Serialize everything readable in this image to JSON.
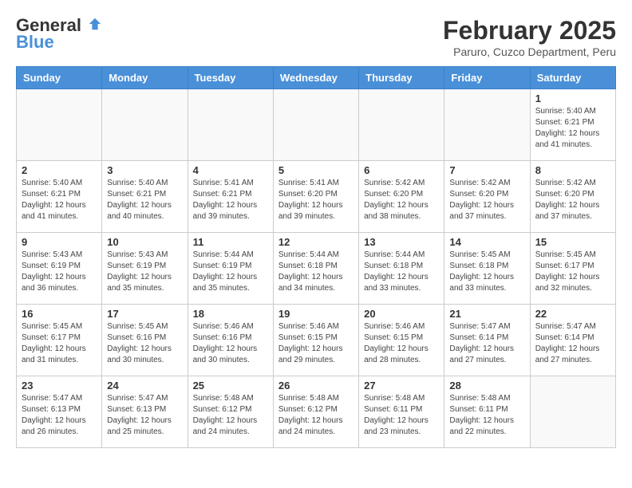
{
  "header": {
    "logo_line1": "General",
    "logo_line2": "Blue",
    "month_year": "February 2025",
    "location": "Paruro, Cuzco Department, Peru"
  },
  "weekdays": [
    "Sunday",
    "Monday",
    "Tuesday",
    "Wednesday",
    "Thursday",
    "Friday",
    "Saturday"
  ],
  "weeks": [
    [
      {
        "day": "",
        "info": ""
      },
      {
        "day": "",
        "info": ""
      },
      {
        "day": "",
        "info": ""
      },
      {
        "day": "",
        "info": ""
      },
      {
        "day": "",
        "info": ""
      },
      {
        "day": "",
        "info": ""
      },
      {
        "day": "1",
        "info": "Sunrise: 5:40 AM\nSunset: 6:21 PM\nDaylight: 12 hours and 41 minutes."
      }
    ],
    [
      {
        "day": "2",
        "info": "Sunrise: 5:40 AM\nSunset: 6:21 PM\nDaylight: 12 hours and 41 minutes."
      },
      {
        "day": "3",
        "info": "Sunrise: 5:40 AM\nSunset: 6:21 PM\nDaylight: 12 hours and 40 minutes."
      },
      {
        "day": "4",
        "info": "Sunrise: 5:41 AM\nSunset: 6:21 PM\nDaylight: 12 hours and 39 minutes."
      },
      {
        "day": "5",
        "info": "Sunrise: 5:41 AM\nSunset: 6:20 PM\nDaylight: 12 hours and 39 minutes."
      },
      {
        "day": "6",
        "info": "Sunrise: 5:42 AM\nSunset: 6:20 PM\nDaylight: 12 hours and 38 minutes."
      },
      {
        "day": "7",
        "info": "Sunrise: 5:42 AM\nSunset: 6:20 PM\nDaylight: 12 hours and 37 minutes."
      },
      {
        "day": "8",
        "info": "Sunrise: 5:42 AM\nSunset: 6:20 PM\nDaylight: 12 hours and 37 minutes."
      }
    ],
    [
      {
        "day": "9",
        "info": "Sunrise: 5:43 AM\nSunset: 6:19 PM\nDaylight: 12 hours and 36 minutes."
      },
      {
        "day": "10",
        "info": "Sunrise: 5:43 AM\nSunset: 6:19 PM\nDaylight: 12 hours and 35 minutes."
      },
      {
        "day": "11",
        "info": "Sunrise: 5:44 AM\nSunset: 6:19 PM\nDaylight: 12 hours and 35 minutes."
      },
      {
        "day": "12",
        "info": "Sunrise: 5:44 AM\nSunset: 6:18 PM\nDaylight: 12 hours and 34 minutes."
      },
      {
        "day": "13",
        "info": "Sunrise: 5:44 AM\nSunset: 6:18 PM\nDaylight: 12 hours and 33 minutes."
      },
      {
        "day": "14",
        "info": "Sunrise: 5:45 AM\nSunset: 6:18 PM\nDaylight: 12 hours and 33 minutes."
      },
      {
        "day": "15",
        "info": "Sunrise: 5:45 AM\nSunset: 6:17 PM\nDaylight: 12 hours and 32 minutes."
      }
    ],
    [
      {
        "day": "16",
        "info": "Sunrise: 5:45 AM\nSunset: 6:17 PM\nDaylight: 12 hours and 31 minutes."
      },
      {
        "day": "17",
        "info": "Sunrise: 5:45 AM\nSunset: 6:16 PM\nDaylight: 12 hours and 30 minutes."
      },
      {
        "day": "18",
        "info": "Sunrise: 5:46 AM\nSunset: 6:16 PM\nDaylight: 12 hours and 30 minutes."
      },
      {
        "day": "19",
        "info": "Sunrise: 5:46 AM\nSunset: 6:15 PM\nDaylight: 12 hours and 29 minutes."
      },
      {
        "day": "20",
        "info": "Sunrise: 5:46 AM\nSunset: 6:15 PM\nDaylight: 12 hours and 28 minutes."
      },
      {
        "day": "21",
        "info": "Sunrise: 5:47 AM\nSunset: 6:14 PM\nDaylight: 12 hours and 27 minutes."
      },
      {
        "day": "22",
        "info": "Sunrise: 5:47 AM\nSunset: 6:14 PM\nDaylight: 12 hours and 27 minutes."
      }
    ],
    [
      {
        "day": "23",
        "info": "Sunrise: 5:47 AM\nSunset: 6:13 PM\nDaylight: 12 hours and 26 minutes."
      },
      {
        "day": "24",
        "info": "Sunrise: 5:47 AM\nSunset: 6:13 PM\nDaylight: 12 hours and 25 minutes."
      },
      {
        "day": "25",
        "info": "Sunrise: 5:48 AM\nSunset: 6:12 PM\nDaylight: 12 hours and 24 minutes."
      },
      {
        "day": "26",
        "info": "Sunrise: 5:48 AM\nSunset: 6:12 PM\nDaylight: 12 hours and 24 minutes."
      },
      {
        "day": "27",
        "info": "Sunrise: 5:48 AM\nSunset: 6:11 PM\nDaylight: 12 hours and 23 minutes."
      },
      {
        "day": "28",
        "info": "Sunrise: 5:48 AM\nSunset: 6:11 PM\nDaylight: 12 hours and 22 minutes."
      },
      {
        "day": "",
        "info": ""
      }
    ]
  ]
}
